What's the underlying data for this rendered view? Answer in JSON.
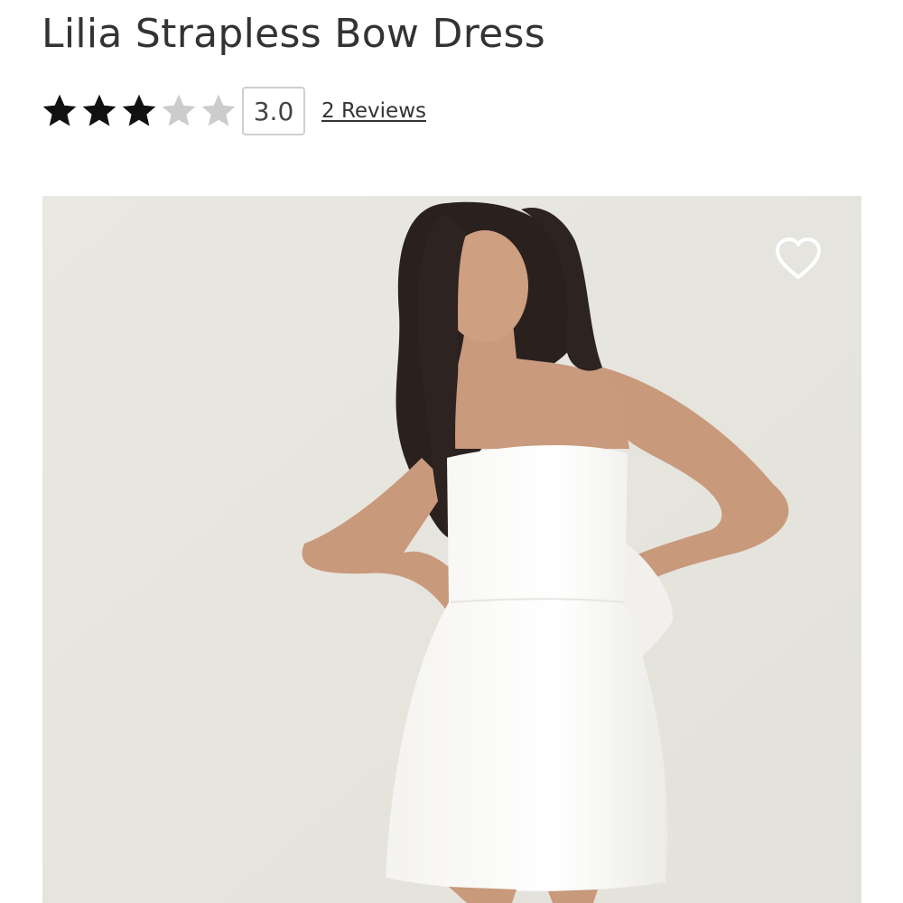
{
  "product": {
    "title": "Lilia Strapless Bow Dress"
  },
  "rating": {
    "value": 3,
    "max": 5,
    "score_label": "3.0",
    "reviews_label": "2 Reviews",
    "star_filled_color": "#111111",
    "star_empty_color": "#cccccc"
  },
  "gallery": {
    "image_alt": "Model wearing white strapless bow mini dress",
    "background_color": "#e8e7e0",
    "wishlist_icon": "heart-outline-icon"
  }
}
